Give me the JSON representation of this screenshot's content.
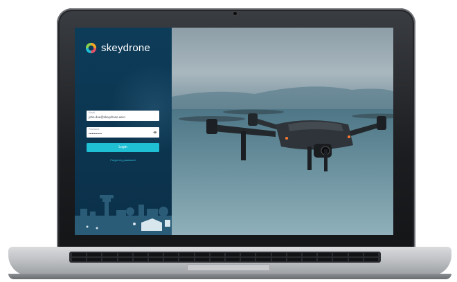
{
  "brand": {
    "name": "skeydrone"
  },
  "login_form": {
    "email": {
      "label": "Email",
      "value": "john.doe@skeydrone.aero"
    },
    "password": {
      "label": "Password",
      "value": "••••••••••••"
    },
    "login_button": "Login",
    "forgot_link": "Forgot my password"
  },
  "colors": {
    "panel": "#0d3c59",
    "accent": "#1fbfd4",
    "link": "#32c6dc"
  },
  "icons": {
    "password_toggle": "eye-icon",
    "logo": "skeydrone-logo-icon"
  }
}
